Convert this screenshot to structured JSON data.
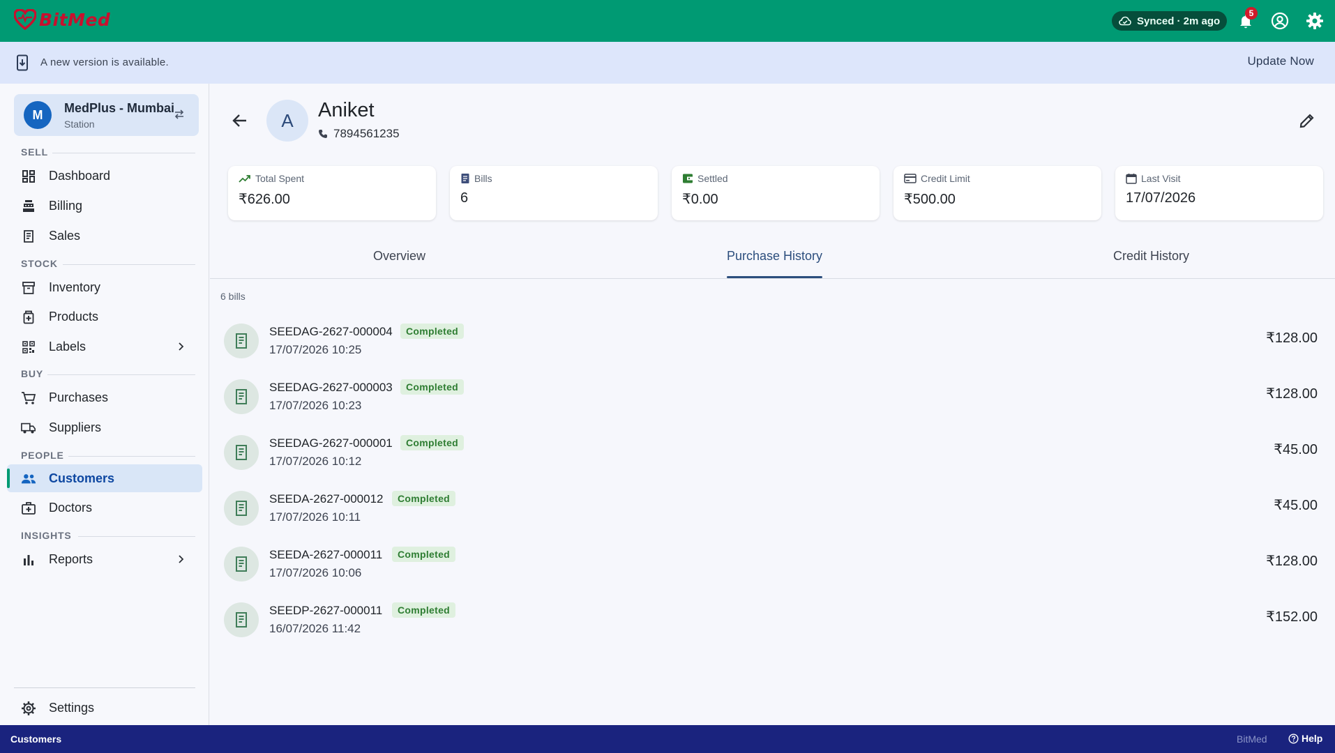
{
  "app": {
    "brand": "BitMed"
  },
  "topbar": {
    "sync_status": "Synced · 2m ago",
    "notification_count": "5",
    "icons": [
      "cloud-icon",
      "bell-icon",
      "account-icon",
      "gear-icon"
    ],
    "accent_color": "#009a73"
  },
  "banner": {
    "message": "A new version is available.",
    "action": "Update Now"
  },
  "sidebar": {
    "store": {
      "initial": "M",
      "name": "MedPlus - Mumbai",
      "type": "Station"
    },
    "sections": {
      "sell": "SELL",
      "stock": "STOCK",
      "buy": "BUY",
      "people": "PEOPLE",
      "insights": "INSIGHTS"
    },
    "items": {
      "dashboard": "Dashboard",
      "billing": "Billing",
      "sales": "Sales",
      "inventory": "Inventory",
      "products": "Products",
      "labels": "Labels",
      "purchases": "Purchases",
      "suppliers": "Suppliers",
      "customers": "Customers",
      "doctors": "Doctors",
      "reports": "Reports",
      "settings": "Settings"
    },
    "active_item": "Customers"
  },
  "customer": {
    "initial": "A",
    "name": "Aniket",
    "phone": "7894561235"
  },
  "stats": [
    {
      "label": "Total Spent",
      "value": "₹626.00"
    },
    {
      "label": "Bills",
      "value": "6"
    },
    {
      "label": "Settled",
      "value": "₹0.00"
    },
    {
      "label": "Credit Limit",
      "value": "₹500.00"
    },
    {
      "label": "Last Visit",
      "value": "17/07/2026"
    }
  ],
  "tabs": {
    "overview": "Overview",
    "purchase_history": "Purchase History",
    "credit_history": "Credit History",
    "active": "Purchase History"
  },
  "bills_count": "6 bills",
  "bills": [
    {
      "number": "SEEDAG-2627-000004",
      "status": "Completed",
      "datetime": "17/07/2026 10:25",
      "amount": "₹128.00"
    },
    {
      "number": "SEEDAG-2627-000003",
      "status": "Completed",
      "datetime": "17/07/2026 10:23",
      "amount": "₹128.00"
    },
    {
      "number": "SEEDAG-2627-000001",
      "status": "Completed",
      "datetime": "17/07/2026 10:12",
      "amount": "₹45.00"
    },
    {
      "number": "SEEDA-2627-000012",
      "status": "Completed",
      "datetime": "17/07/2026 10:11",
      "amount": "₹45.00"
    },
    {
      "number": "SEEDA-2627-000011",
      "status": "Completed",
      "datetime": "17/07/2026 10:06",
      "amount": "₹128.00"
    },
    {
      "number": "SEEDP-2627-000011",
      "status": "Completed",
      "datetime": "16/07/2026 11:42",
      "amount": "₹152.00"
    }
  ],
  "footer": {
    "current_page": "Customers",
    "brand": "BitMed",
    "help": "Help"
  }
}
